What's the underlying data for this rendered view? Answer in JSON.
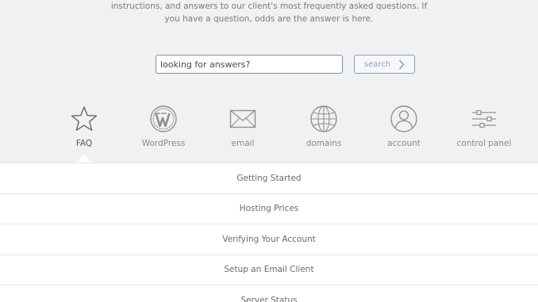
{
  "intro": {
    "line1": "instructions, and answers to our client's most frequently asked questions. If",
    "line2": "you have a question, odds are the answer is here."
  },
  "search": {
    "value": "looking for answers?",
    "button_label": "search"
  },
  "categories": [
    {
      "label": "FAQ",
      "icon": "star-icon",
      "active": true
    },
    {
      "label": "WordPress",
      "icon": "wordpress-icon",
      "active": false
    },
    {
      "label": "email",
      "icon": "envelope-icon",
      "active": false
    },
    {
      "label": "domains",
      "icon": "globe-icon",
      "active": false
    },
    {
      "label": "account",
      "icon": "user-icon",
      "active": false
    },
    {
      "label": "control panel",
      "icon": "sliders-icon",
      "active": false
    }
  ],
  "faq_items": [
    "Getting Started",
    "Hosting Prices",
    "Verifying Your Account",
    "Setup an Email Client",
    "Server Status"
  ],
  "colors": {
    "background": "#f1f1f1",
    "accent": "#6f97c3",
    "icon": "#8a8a8a"
  }
}
